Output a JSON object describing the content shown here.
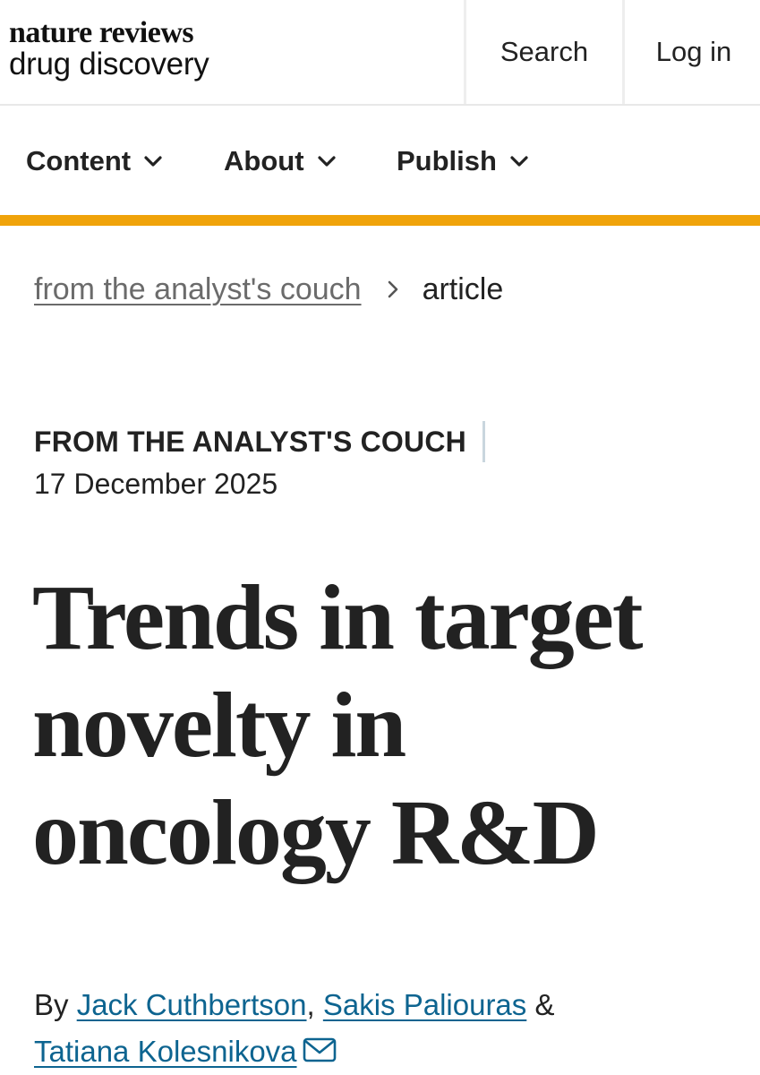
{
  "header": {
    "logo_top": "nature reviews",
    "logo_bottom": "drug discovery",
    "search_label": "Search",
    "login_label": "Log in"
  },
  "nav": {
    "items": [
      {
        "label": "Content",
        "icon": "chevron-down-icon"
      },
      {
        "label": "About",
        "icon": "chevron-down-icon"
      },
      {
        "label": "Publish",
        "icon": "chevron-down-icon"
      }
    ]
  },
  "breadcrumb": {
    "link": "from the analyst's couch",
    "current": "article"
  },
  "article": {
    "type": "FROM THE ANALYST'S COUCH",
    "date": "17 December 2025",
    "title": "Trends in target novelty in oncology R&D",
    "by": "By",
    "authors": [
      "Jack Cuthbertson",
      "Sakis Paliouras",
      "Tatiana Kolesnikova"
    ],
    "sep_comma": ",",
    "sep_amp": "&"
  },
  "colors": {
    "accent": "#f0a30a",
    "link": "#0d6490",
    "text": "#222222"
  }
}
